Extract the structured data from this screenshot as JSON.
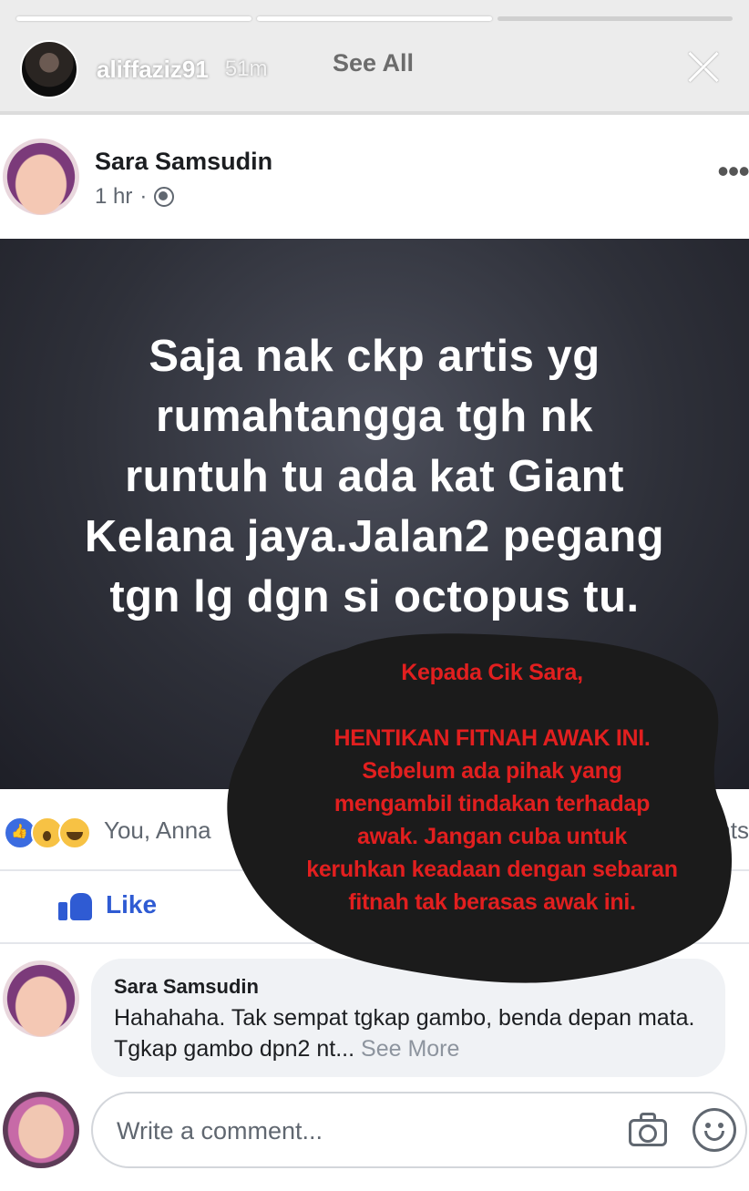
{
  "story": {
    "username": "aliffaziz91",
    "time": "51m",
    "see_all": "See All",
    "progress_segments": 3,
    "progress_completed": 2
  },
  "post": {
    "author": "Sara Samsudin",
    "time": "1 hr",
    "separator": "·",
    "more_icon": "•••",
    "text_lines": [
      "Saja nak ckp artis yg",
      "rumahtangga tgh nk",
      "runtuh tu ada kat Giant",
      "Kelana jaya.Jalan2 pegang",
      "tgn lg dgn si octopus tu."
    ],
    "background_color": "#2e3039"
  },
  "reactions": {
    "icons": [
      "like-icon",
      "wow-icon",
      "haha-icon"
    ],
    "names": "You, Anna",
    "right_text": "nts"
  },
  "actions": {
    "like_label": "Like"
  },
  "comment": {
    "author": "Sara Samsudin",
    "text": "Hahahaha. Tak sempat tgkap gambo, benda depan mata. Tgkap gambo dpn2 nt...",
    "see_more": "See More"
  },
  "composer": {
    "placeholder": "Write a comment..."
  },
  "overlay_note": {
    "greeting": "Kepada Cik Sara,",
    "lines": [
      "HENTIKAN FITNAH AWAK INI.",
      "Sebelum ada pihak yang",
      "mengambil tindakan terhadap",
      "awak. Jangan cuba untuk",
      "keruhkan keadaan dengan sebaran",
      "fitnah tak berasas awak ini."
    ],
    "text_color": "#e21f1f",
    "blob_color": "#1b1b1b"
  },
  "colors": {
    "facebook_blue": "#2f5bd3",
    "secondary_text": "#606770",
    "primary_text": "#1c1e21"
  }
}
